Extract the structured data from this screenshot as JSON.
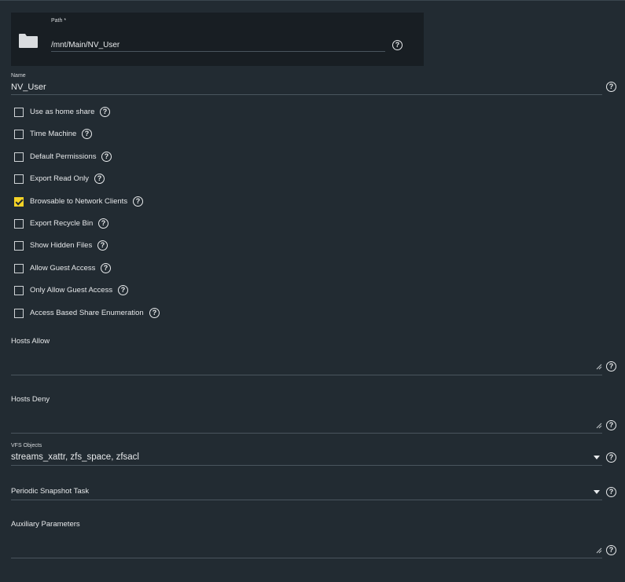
{
  "path": {
    "label": "Path *",
    "value": "/mnt/Main/NV_User",
    "icon": "folder-icon"
  },
  "name": {
    "label": "Name",
    "value": "NV_User"
  },
  "checkboxes": [
    {
      "label": "Use as home share",
      "checked": false
    },
    {
      "label": "Time Machine",
      "checked": false
    },
    {
      "label": "Default Permissions",
      "checked": false
    },
    {
      "label": "Export Read Only",
      "checked": false
    },
    {
      "label": "Browsable to Network Clients",
      "checked": true
    },
    {
      "label": "Export Recycle Bin",
      "checked": false
    },
    {
      "label": "Show Hidden Files",
      "checked": false
    },
    {
      "label": "Allow Guest Access",
      "checked": false
    },
    {
      "label": "Only Allow Guest Access",
      "checked": false
    },
    {
      "label": "Access Based Share Enumeration",
      "checked": false
    }
  ],
  "hosts_allow": {
    "label": "Hosts Allow",
    "value": ""
  },
  "hosts_deny": {
    "label": "Hosts Deny",
    "value": ""
  },
  "vfs_objects": {
    "label": "VFS Objects",
    "value": "streams_xattr, zfs_space, zfsacl"
  },
  "periodic_snapshot": {
    "label": "Periodic Snapshot Task",
    "value": ""
  },
  "auxiliary": {
    "label": "Auxiliary Parameters",
    "value": ""
  },
  "help_glyph": "?",
  "colors": {
    "background": "#222b32",
    "path_panel": "#181e23",
    "checkbox_checked": "#f5d327",
    "underline": "#4a555e"
  }
}
